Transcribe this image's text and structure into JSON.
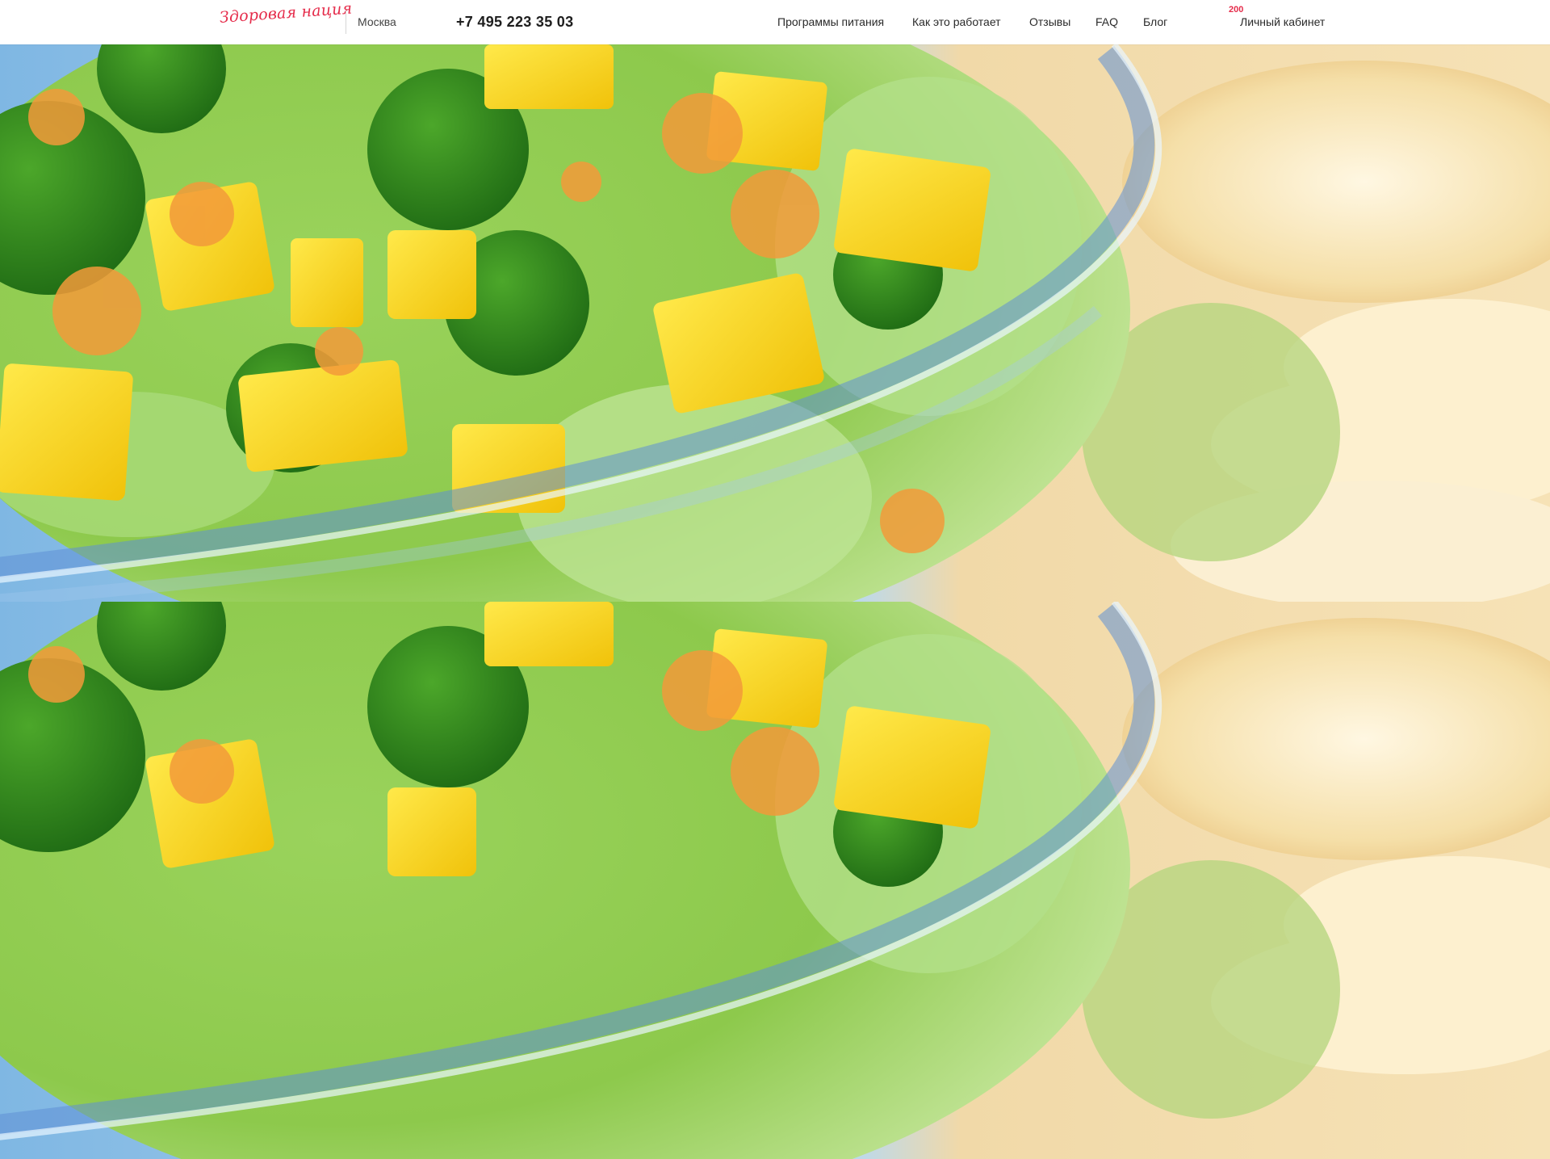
{
  "header": {
    "logo_text": "Здоровая нация",
    "city": "Москва",
    "phone": "+7 495 223 35 03",
    "nav": {
      "programs": "Программы питания",
      "how_it_works": "Как это работает",
      "reviews": "Отзывы",
      "faq": "FAQ",
      "blog": "Блог",
      "account": "Личный кабинет"
    },
    "badge_count": "200"
  },
  "colors": {
    "brand": "#e52b4a",
    "text": "#2a2a2a"
  },
  "hero": {
    "image": "salad-bowl-with-broccoli-mango-carrot-and-bread"
  }
}
